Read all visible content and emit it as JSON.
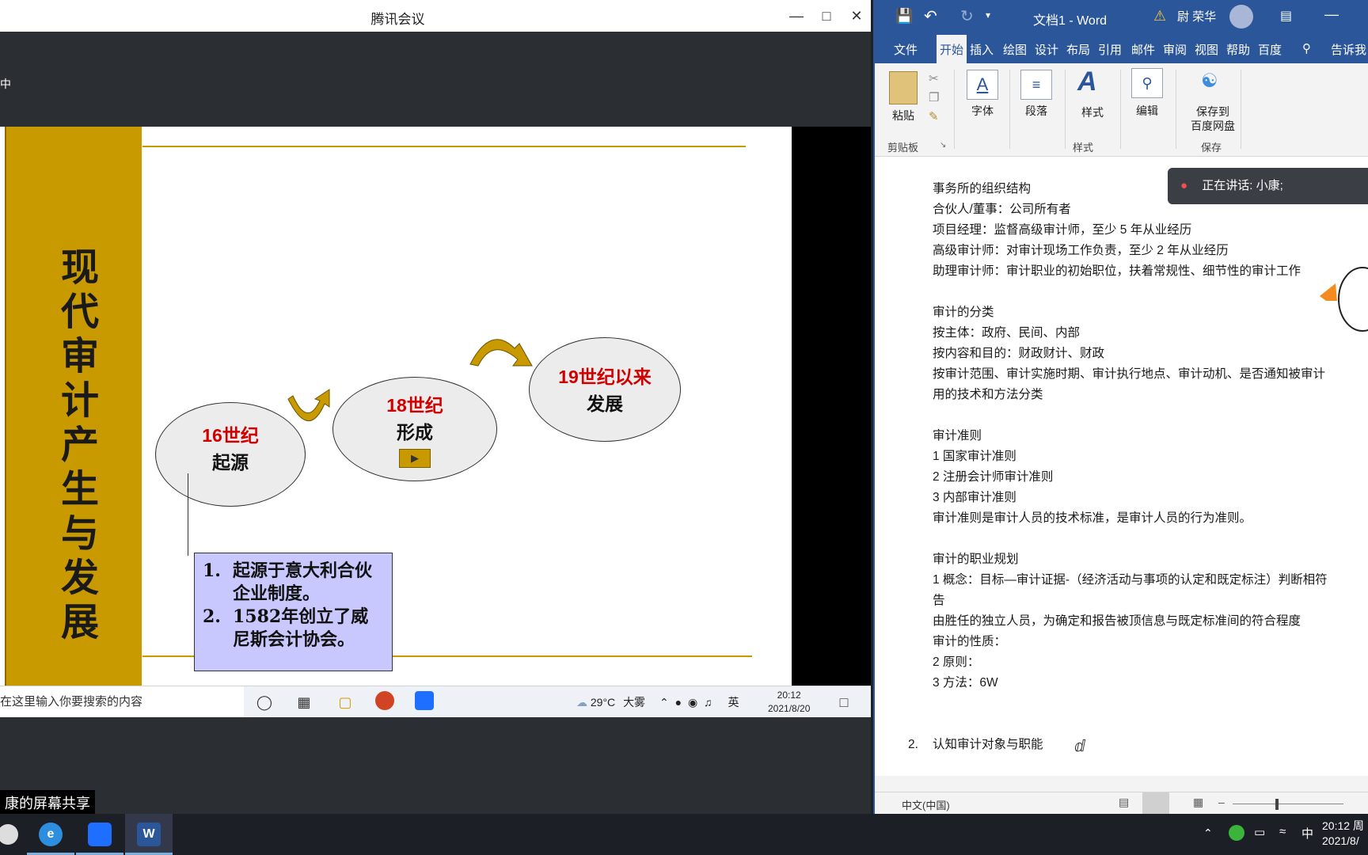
{
  "meeting": {
    "title": "腾讯会议",
    "topbar_text": "中",
    "share_label": "康的屏幕共享"
  },
  "slide": {
    "title": "现代审计产生与发展",
    "stages": [
      {
        "year": "16世纪",
        "label": "起源"
      },
      {
        "year": "18世纪",
        "label": "形成"
      },
      {
        "year": "19世纪以来",
        "label": "发展"
      }
    ],
    "notes": [
      {
        "num": "1.",
        "text": "起源于意大利合伙企业制度。"
      },
      {
        "num": "2.",
        "text": "1582年创立了威尼斯会计协会。"
      }
    ]
  },
  "shared_taskbar": {
    "search_placeholder": "在这里输入你要搜索的内容",
    "weather": "29°C",
    "weather_desc": "大雾",
    "ime": "英",
    "time": "20:12",
    "date": "2021/8/20"
  },
  "word": {
    "title": "文档1 - Word",
    "user": "尉 荣华",
    "tabs": [
      "文件",
      "开始",
      "插入",
      "绘图",
      "设计",
      "布局",
      "引用",
      "邮件",
      "审阅",
      "视图",
      "帮助",
      "百度",
      "告诉我"
    ],
    "active_tab": "开始",
    "ribbon": {
      "paste": "粘贴",
      "clipboard": "剪贴板",
      "font": "字体",
      "paragraph": "段落",
      "styles": "样式",
      "styles_group": "样式",
      "editing": "编辑",
      "save_to": "保存到",
      "baidu_disk": "百度网盘",
      "save_group": "保存"
    },
    "speaking": "正在讲话: 小康;",
    "doc_lines": [
      "事务所的组织结构",
      "合伙人/董事：公司所有者",
      "项目经理：监督高级审计师，至少 5 年从业经历",
      "高级审计师：对审计现场工作负责，至少 2 年从业经历",
      "助理审计师：审计职业的初始职位，扶着常规性、细节性的审计工作",
      "",
      "审计的分类",
      "按主体：政府、民间、内部",
      "按内容和目的：财政财计、财政",
      "按审计范围、审计实施时期、审计执行地点、审计动机、是否通知被审计",
      "用的技术和方法分类",
      "",
      "审计准则",
      "1 国家审计准则",
      "2 注册会计师审计准则",
      "3 内部审计准则",
      "审计准则是审计人员的技术标准，是审计人员的行为准则。",
      "",
      "审计的职业规划",
      "1 概念：目标—审计证据-（经济活动与事项的认定和既定标注）判断相符",
      "告",
      "由胜任的独立人员，为确定和报告被顶信息与既定标准间的符合程度",
      "审计的性质：",
      "2 原则：",
      "3 方法：6W"
    ],
    "list_number": "2.",
    "list_item": "认知审计对象与职能",
    "status_lang": "中文(中国)"
  },
  "taskbar": {
    "ime": "中",
    "time": "20:12 周",
    "date": "2021/8/"
  },
  "colors": {
    "word_blue": "#2b579a",
    "slide_gold": "#c99a00",
    "stage_year_red": "#d10000",
    "note_box": "#c8c8ff"
  }
}
